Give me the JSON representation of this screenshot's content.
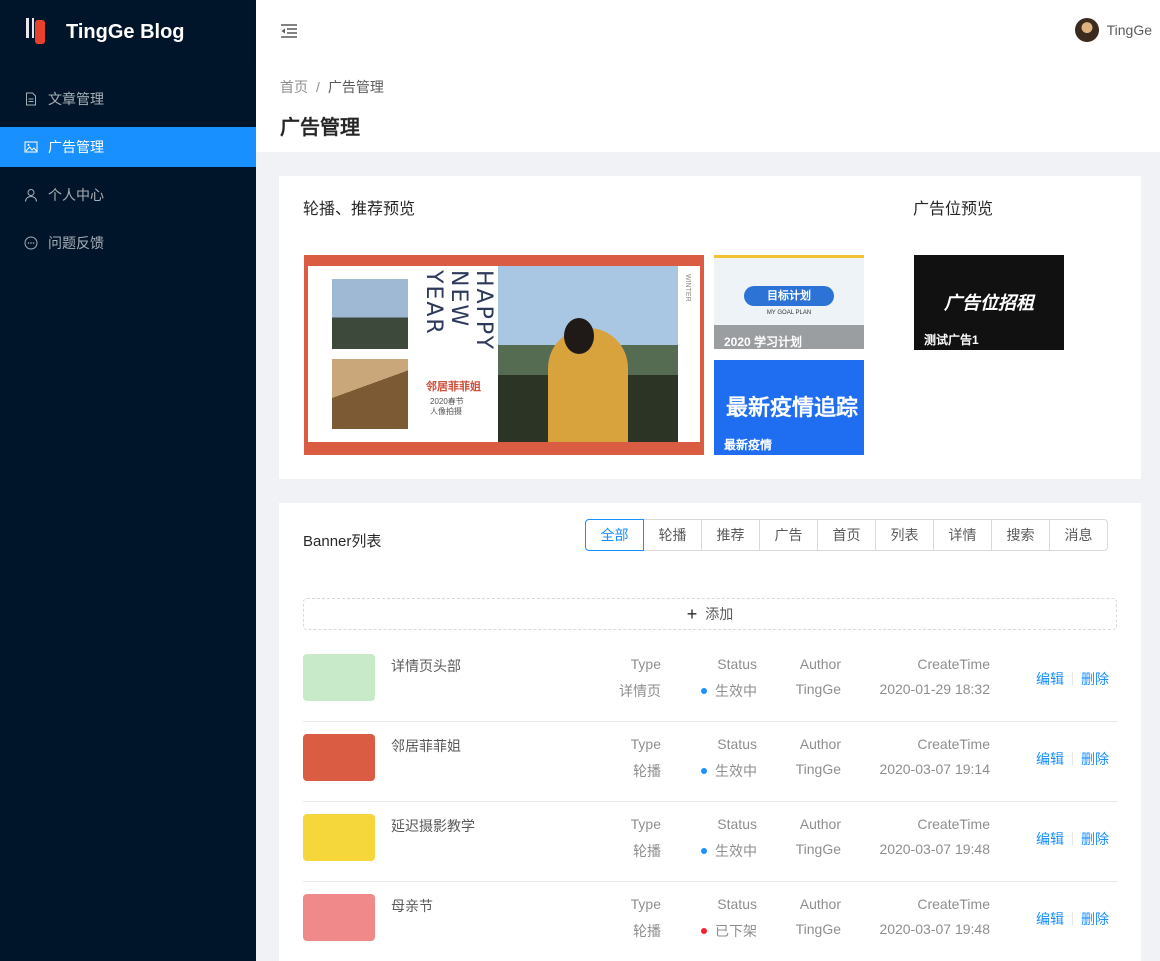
{
  "app": {
    "title": "TingGe Blog"
  },
  "sidebar": {
    "items": [
      {
        "label": "文章管理",
        "icon": "file-icon",
        "active": false
      },
      {
        "label": "广告管理",
        "icon": "picture-icon",
        "active": true
      },
      {
        "label": "个人中心",
        "icon": "user-icon",
        "active": false
      },
      {
        "label": "问题反馈",
        "icon": "message-icon",
        "active": false
      }
    ]
  },
  "header": {
    "user_name": "TingGe"
  },
  "breadcrumb": {
    "home": "首页",
    "separator": "/",
    "current": "广告管理"
  },
  "page": {
    "title": "广告管理"
  },
  "preview": {
    "carousel_heading": "轮播、推荐预览",
    "ad_heading": "广告位预览",
    "main_banner": {
      "headline": "HAPPY NEW YEAR",
      "name": "邻居菲菲姐",
      "subtitle_line1": "2020春节",
      "subtitle_line2": "人像拍摄",
      "side_text": "WINTER"
    },
    "side_banners": [
      {
        "caption": "2020 学习计划",
        "graphic_text": "目标计划",
        "graphic_sub": "MY GOAL PLAN"
      },
      {
        "caption": "最新疫情",
        "graphic_text": "最新疫情追踪"
      }
    ],
    "ad": {
      "graphic_text": "广告位招租",
      "caption": "测试广告1"
    }
  },
  "banner_list": {
    "heading": "Banner列表",
    "filters": [
      "全部",
      "轮播",
      "推荐",
      "广告",
      "首页",
      "列表",
      "详情",
      "搜索",
      "消息"
    ],
    "active_filter": "全部",
    "add_label": "添加",
    "col_labels": {
      "type": "Type",
      "status": "Status",
      "author": "Author",
      "time": "CreateTime"
    },
    "action_edit": "编辑",
    "action_delete": "删除",
    "rows": [
      {
        "title": "详情页头部",
        "type": "详情页",
        "status": "生效中",
        "status_color": "#1890ff",
        "author": "TingGe",
        "time": "2020-01-29 18:32"
      },
      {
        "title": "邻居菲菲姐",
        "type": "轮播",
        "status": "生效中",
        "status_color": "#1890ff",
        "author": "TingGe",
        "time": "2020-03-07 19:14"
      },
      {
        "title": "延迟摄影教学",
        "type": "轮播",
        "status": "生效中",
        "status_color": "#1890ff",
        "author": "TingGe",
        "time": "2020-03-07 19:48"
      },
      {
        "title": "母亲节",
        "type": "轮播",
        "status": "已下架",
        "status_color": "#f5222d",
        "author": "TingGe",
        "time": "2020-03-07 19:48"
      }
    ]
  },
  "colors": {
    "primary": "#1890ff",
    "sider": "#001529",
    "error": "#f5222d"
  }
}
